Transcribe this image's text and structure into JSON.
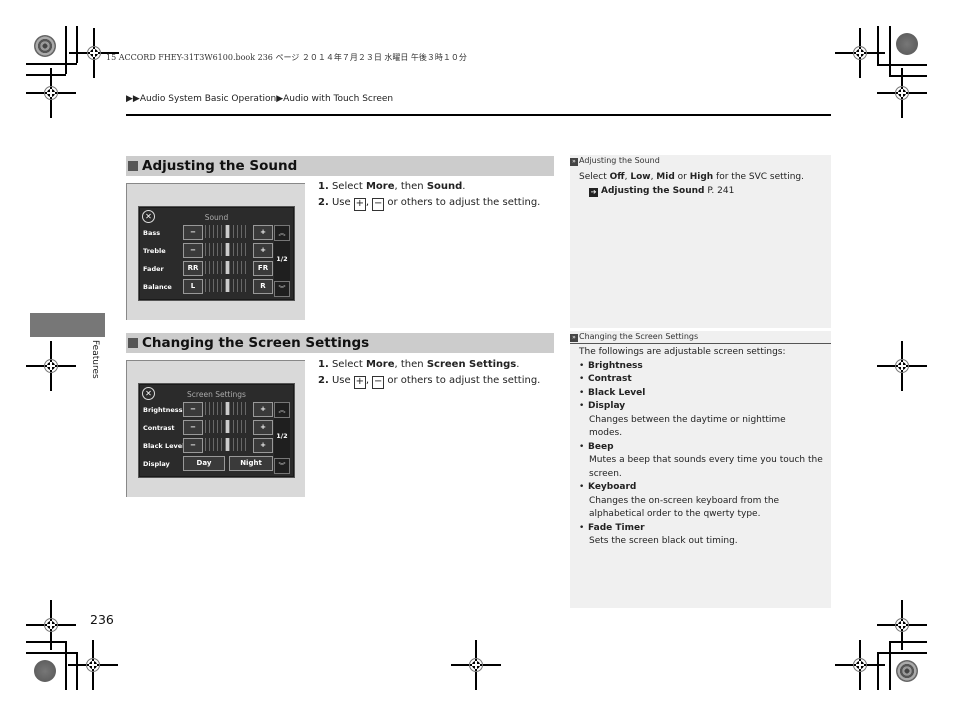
{
  "print_header": "15 ACCORD FHEY-31T3W6100.book  236 ページ  ２０１４年７月２３日  水曜日  午後３時１０分",
  "breadcrumb": {
    "prefix": "▶▶",
    "items": [
      "Audio System Basic Operation",
      "Audio with Touch Screen"
    ],
    "separator": "▶"
  },
  "side_tab": "Features",
  "page_number": "236",
  "sections": [
    {
      "title": "Adjusting the Sound",
      "screen": {
        "title": "Sound",
        "rows": [
          {
            "label": "Bass",
            "left": "−",
            "right": "+"
          },
          {
            "label": "Treble",
            "left": "−",
            "right": "+"
          },
          {
            "label": "Fader",
            "left": "RR",
            "right": "FR"
          },
          {
            "label": "Balance",
            "left": "L",
            "right": "R"
          }
        ],
        "page": "1/2",
        "up_arrow": "︽",
        "down_arrow": "︾"
      },
      "steps": [
        {
          "num": "1.",
          "pre": "Select ",
          "b1": "More",
          "mid": ", then ",
          "b2": "Sound",
          "post": "."
        },
        {
          "num": "2.",
          "pre": "Use ",
          "plus": "+",
          "sep": ", ",
          "minus": "−",
          "post": " or others to adjust the setting."
        }
      ],
      "note": {
        "title": "Adjusting the Sound",
        "text_pre": "Select ",
        "opt1": "Off",
        "c1": ", ",
        "opt2": "Low",
        "c2": ", ",
        "opt3": "Mid",
        "c3": " or ",
        "opt4": "High",
        "text_post": " for the SVC setting.",
        "xref_title": "Adjusting the Sound",
        "xref_page": "P. 241"
      }
    },
    {
      "title": "Changing the Screen Settings",
      "screen": {
        "title": "Screen Settings",
        "rows": [
          {
            "label": "Brightness",
            "left": "−",
            "right": "+"
          },
          {
            "label": "Contrast",
            "left": "−",
            "right": "+"
          },
          {
            "label": "Black Level",
            "left": "−",
            "right": "+"
          },
          {
            "label": "Display",
            "left": "Day",
            "right": "Night"
          }
        ],
        "page": "1/2",
        "up_arrow": "︽",
        "down_arrow": "︾"
      },
      "steps": [
        {
          "num": "1.",
          "pre": "Select ",
          "b1": "More",
          "mid": ", then ",
          "b2": "Screen Settings",
          "post": "."
        },
        {
          "num": "2.",
          "pre": "Use ",
          "plus": "+",
          "sep": ", ",
          "minus": "−",
          "post": " or others to adjust the setting."
        }
      ],
      "note": {
        "title": "Changing the Screen Settings",
        "intro": "The followings are adjustable screen settings:",
        "items": [
          {
            "name": "Brightness",
            "desc": ""
          },
          {
            "name": "Contrast",
            "desc": ""
          },
          {
            "name": "Black Level",
            "desc": ""
          },
          {
            "name": "Display",
            "desc": "Changes between the daytime or nighttime modes."
          },
          {
            "name": "Beep",
            "desc": "Mutes a beep that sounds every time you touch the screen."
          },
          {
            "name": "Keyboard",
            "desc": "Changes the on-screen keyboard from the alphabetical order to the qwerty type."
          },
          {
            "name": "Fade Timer",
            "desc": "Sets the screen black out timing."
          }
        ]
      }
    }
  ]
}
